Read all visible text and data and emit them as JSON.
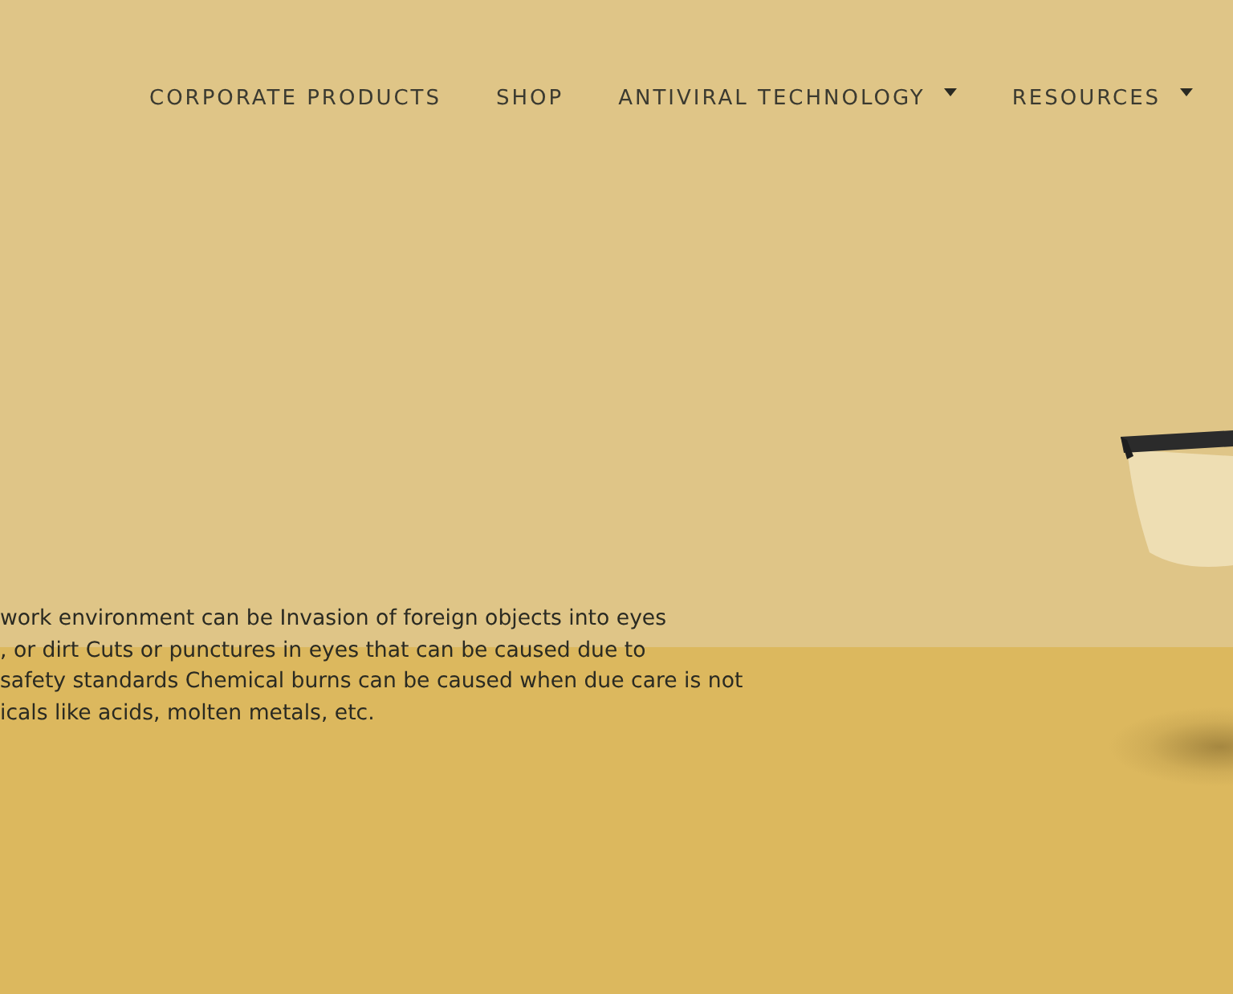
{
  "nav": {
    "items": [
      {
        "label": "CORPORATE PRODUCTS",
        "dropdown": false
      },
      {
        "label": "SHOP",
        "dropdown": false
      },
      {
        "label": "ANTIVIRAL TECHNOLOGY",
        "dropdown": true
      },
      {
        "label": "RESOURCES",
        "dropdown": true
      }
    ]
  },
  "body": {
    "lines": [
      "work environment can be Invasion of foreign objects into eyes",
      ", or dirt Cuts or punctures in eyes that can be caused due to",
      "safety standards Chemical burns can be caused when due care is not",
      "icals like acids, molten metals, etc."
    ]
  }
}
